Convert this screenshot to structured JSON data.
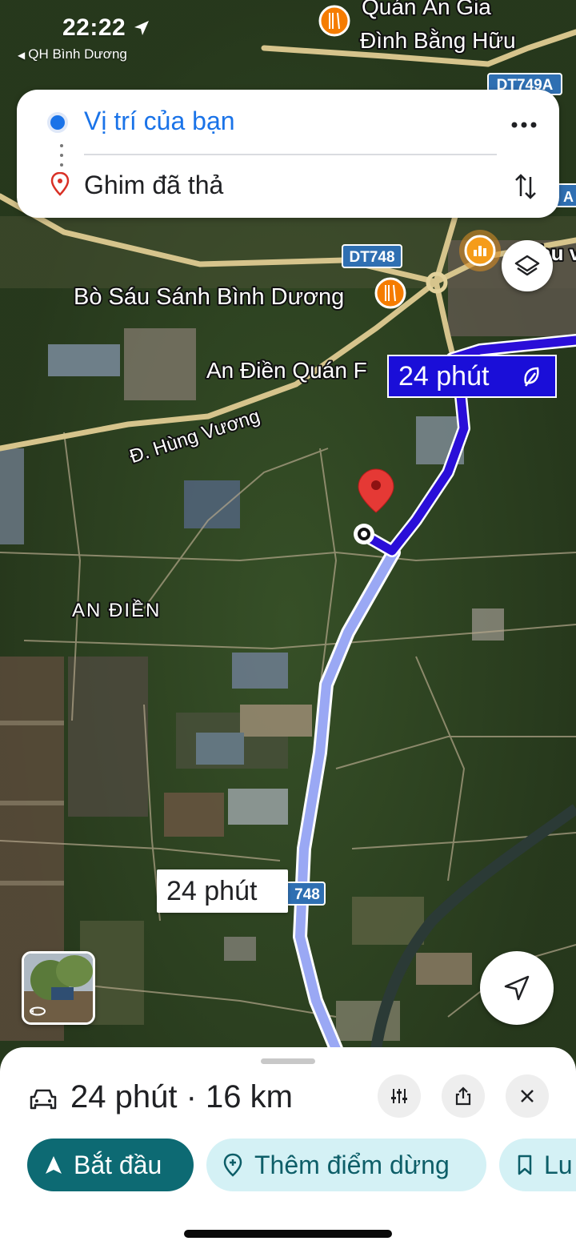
{
  "status_bar": {
    "time": "22:22",
    "back_app": "QH Bình Dương"
  },
  "directions": {
    "origin": "Vị trí của bạn",
    "destination": "Ghim đã thả"
  },
  "map": {
    "labels": {
      "top_place_line1": "Quán Ăn Gia",
      "top_place_line2": "Đình Bằng Hữu",
      "road_dt749a": "DT749A",
      "road_dt748": "DT748",
      "place_bo_sau": "Bò Sáu Sánh Bình Dương",
      "place_an_dien_quan": "An Điền Quán F",
      "street_hung_vuong": "Đ. Hùng Vương",
      "area_an_dien": "AN ĐIỀN",
      "road_748_partial": "748",
      "right_edge_text": "Khu v",
      "right_edge_letter": "A"
    },
    "route_bubble_primary": "24 phút",
    "route_bubble_alt": "24 phút"
  },
  "bottom_sheet": {
    "summary": "24 phút · 16 km",
    "start_label": "Bắt đầu",
    "add_stop_label": "Thêm điểm dừng",
    "save_label": "Lu"
  }
}
